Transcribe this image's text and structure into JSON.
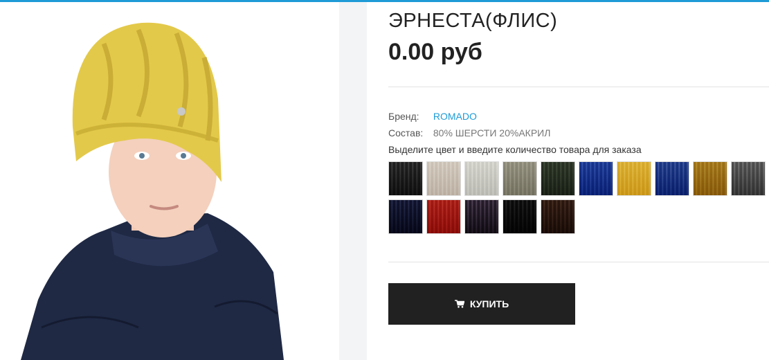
{
  "product": {
    "title": "ЭРНЕСТА(ФЛИС)",
    "price": "0.00 руб",
    "brand_label": "Бренд:",
    "brand_value": "ROMADO",
    "composition_label": "Состав:",
    "composition_value": "80% ШЕРСТИ 20%АКРИЛ",
    "color_hint": "Выделите цвет и введите количество товара для заказа",
    "buy_label": "КУПИТЬ"
  },
  "swatches": [
    {
      "color": "#3a3a3a",
      "stripe": "#8a8a8a"
    },
    {
      "color": "#d9d2ca",
      "stripe": "#f0ece6"
    },
    {
      "color": "#d8d8d4",
      "stripe": "#f2f2ee"
    },
    {
      "color": "#a9a79a",
      "stripe": "#d3d1c6"
    },
    {
      "color": "#4b5546",
      "stripe": "#8a9483"
    },
    {
      "color": "#2f56a8",
      "stripe": "#7f9cd8"
    },
    {
      "color": "#e2c24a",
      "stripe": "#f3e095"
    },
    {
      "color": "#2f55a3",
      "stripe": "#8fa3cf"
    },
    {
      "color": "#b6932f",
      "stripe": "#dcc57a"
    },
    {
      "color": "#6d6d6d",
      "stripe": "#b8b8b8"
    },
    {
      "color": "#242a4a",
      "stripe": "#6e7396"
    },
    {
      "color": "#b8342a",
      "stripe": "#e07d73"
    },
    {
      "color": "#3e3442",
      "stripe": "#9a8ea0"
    },
    {
      "color": "#1a1a1a",
      "stripe": "#6a6a6a"
    },
    {
      "color": "#4a3327",
      "stripe": "#927565"
    }
  ]
}
